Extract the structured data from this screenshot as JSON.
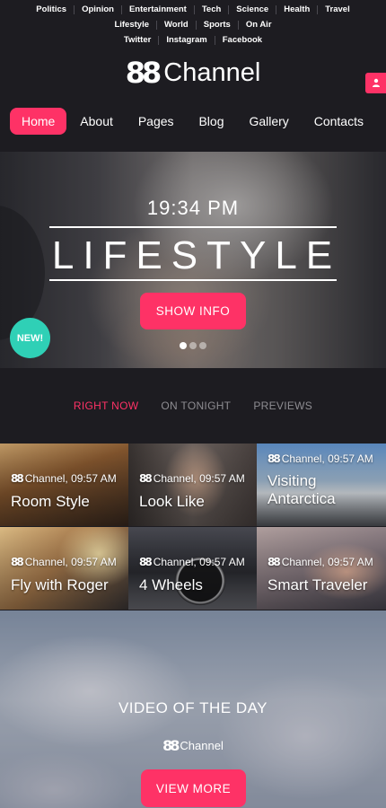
{
  "topbar": {
    "row1": [
      "Politics",
      "Opinion",
      "Entertainment",
      "Tech",
      "Science",
      "Health",
      "Travel"
    ],
    "row2": [
      "Lifestyle",
      "World",
      "Sports",
      "On Air"
    ],
    "row3": [
      "Twitter",
      "Instagram",
      "Facebook"
    ]
  },
  "header": {
    "logo_mark": "88",
    "logo_text": "Channel",
    "user_icon": "user-icon"
  },
  "nav": [
    "Home",
    "About",
    "Pages",
    "Blog",
    "Gallery",
    "Contacts"
  ],
  "hero": {
    "time": "19:34 PM",
    "title": "LIFESTYLE",
    "button": "SHOW INFO",
    "badge": "NEW!",
    "slide_count": 3,
    "active_slide": 1
  },
  "tabs": [
    "RIGHT NOW",
    "ON TONIGHT",
    "PREVIEWS"
  ],
  "grid": [
    {
      "meta": "Channel, 09:57 AM",
      "title": "Room Style"
    },
    {
      "meta": "Channel, 09:57 AM",
      "title": "Look Like"
    },
    {
      "meta": "Channel, 09:57 AM",
      "title": "Visiting Antarctica"
    },
    {
      "meta": "Channel, 09:57 AM",
      "title": "Fly with Roger"
    },
    {
      "meta": "Channel, 09:57 AM",
      "title": "4 Wheels"
    },
    {
      "meta": "Channel, 09:57 AM",
      "title": "Smart Traveler"
    }
  ],
  "video": {
    "title": "VIDEO OF THE DAY",
    "logo_mark": "88",
    "logo_text": "Channel",
    "button": "VIEW MORE"
  },
  "colors": {
    "accent": "#fe3266",
    "badge": "#2fd0b6",
    "background": "#1d1c21"
  }
}
